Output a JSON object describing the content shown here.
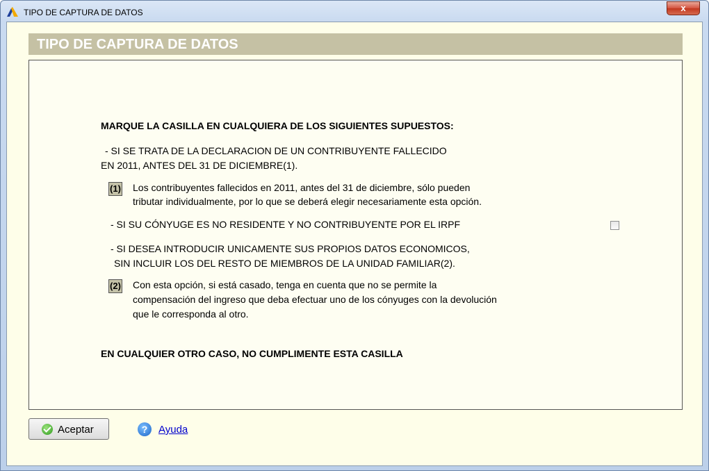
{
  "window": {
    "title": "TIPO DE CAPTURA DE DATOS",
    "close_label": "x"
  },
  "header": {
    "title": "TIPO DE CAPTURA DE DATOS"
  },
  "content": {
    "intro": "MARQUE LA CASILLA EN CUALQUIERA DE LOS SIGUIENTES SUPUESTOS:",
    "case1_line1": "- SI SE TRATA DE LA DECLARACION DE UN CONTRIBUYENTE FALLECIDO",
    "case1_line2": "EN 2011, ANTES DEL 31 DE DICIEMBRE(1).",
    "note1_badge": "(1)",
    "note1_line1": "Los contribuyentes fallecidos en 2011, antes del 31 de diciembre, sólo pueden",
    "note1_line2": "tributar individualmente, por lo que se deberá elegir necesariamente esta opción.",
    "case2": "- SI SU CÓNYUGE ES NO RESIDENTE Y NO CONTRIBUYENTE POR EL IRPF",
    "case3_line1": "- SI DESEA INTRODUCIR UNICAMENTE SUS PROPIOS DATOS ECONOMICOS,",
    "case3_line2": "SIN INCLUIR LOS DEL RESTO DE MIEMBROS DE LA UNIDAD FAMILIAR(2).",
    "note2_badge": "(2)",
    "note2_line1": "Con esta opción, si está casado, tenga en cuenta que no se permite la",
    "note2_line2": "compensación del ingreso que deba efectuar uno de los cónyuges con la devolución",
    "note2_line3": "que le corresponda al otro.",
    "footer_note": "EN CUALQUIER OTRO CASO, NO CUMPLIMENTE ESTA CASILLA",
    "checkbox_checked": false
  },
  "buttons": {
    "accept_label": "Aceptar",
    "help_label": "Ayuda"
  }
}
